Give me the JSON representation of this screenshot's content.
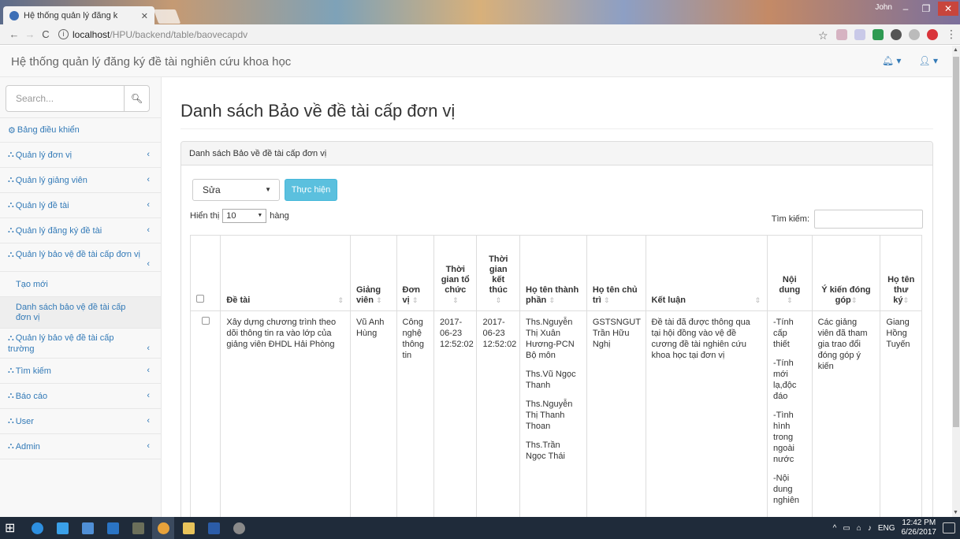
{
  "browser": {
    "tab_title": "Hệ thống quản lý đăng k",
    "url_host": "localhost",
    "url_path": "/HPU/backend/table/baovecapdv",
    "user": "John"
  },
  "app": {
    "brand": "Hệ thống quản lý đăng ký đề tài nghiên cứu khoa học"
  },
  "sidebar": {
    "search_placeholder": "Search...",
    "items": [
      {
        "label": "Bảng điều khiển"
      },
      {
        "label": "Quản lý đơn vị"
      },
      {
        "label": "Quản lý giảng viên"
      },
      {
        "label": "Quản lý đề tài"
      },
      {
        "label": "Quản lý đăng ký đề tài"
      },
      {
        "label": "Quản lý bảo vệ đề tài cấp đơn vị"
      },
      {
        "label": "Tạo mới"
      },
      {
        "label": "Danh sách bảo vệ đề tài cấp đơn vị"
      },
      {
        "label": "Quản lý bảo vệ đề tài cấp trường"
      },
      {
        "label": "Tìm kiếm"
      },
      {
        "label": "Báo cáo"
      },
      {
        "label": "User"
      },
      {
        "label": "Admin"
      }
    ]
  },
  "main": {
    "page_title": "Danh sách Bảo về đề tài cấp đơn vị",
    "panel_heading": "Danh sách Bảo về đề tài cấp đơn vị",
    "action_select": "Sửa",
    "action_button": "Thực hiện",
    "length_prefix": "Hiển thị",
    "length_value": "10",
    "length_suffix": "hàng",
    "filter_label": "Tìm kiếm:"
  },
  "table": {
    "headers": [
      "Đề tài",
      "Giảng viên",
      "Đơn vị",
      "Thời gian tổ chức",
      "Thời gian kết thúc",
      "Họ tên thành phần",
      "Họ tên chủ trì",
      "Kết luận",
      "Nội dung",
      "Ý kiến đóng góp",
      "Họ tên thư ký"
    ],
    "row": {
      "de_tai": "Xây dựng chương trình theo dõi thông tin ra vào lớp của giảng viên ĐHDL Hải Phòng",
      "giang_vien": "Vũ Anh Hùng",
      "don_vi": "Công nghệ thông tin",
      "tg_to_chuc": "2017-06-23 12:52:02",
      "tg_ket_thuc": "2017-06-23 12:52:02",
      "thanh_phan": [
        "Ths.Nguyễn Thị Xuân Hương-PCN Bộ môn",
        "Ths.Vũ Ngọc Thanh",
        "Ths.Nguyễn Thị Thanh Thoan",
        "Ths.Trần Ngọc Thái"
      ],
      "chu_tri": "GSTSNGUT Trần Hữu Nghị",
      "ket_luan": "Đề tài đã được thông qua tại hội đồng vào vệ đề cương đề tài nghiên cứu khoa học tại đơn vị",
      "noi_dung": [
        "-Tính cấp thiết",
        "-Tính mới lạ,độc đáo",
        "-Tình hình trong ngoài nước",
        "-Nội dung nghiên"
      ],
      "y_kien": "Các giảng viên đã tham gia trao đổi đóng góp ý kiến",
      "thu_ky": "Giang Hồng Tuyến"
    }
  },
  "taskbar": {
    "time": "12:42 PM",
    "date": "6/26/2017",
    "lang": "ENG"
  }
}
